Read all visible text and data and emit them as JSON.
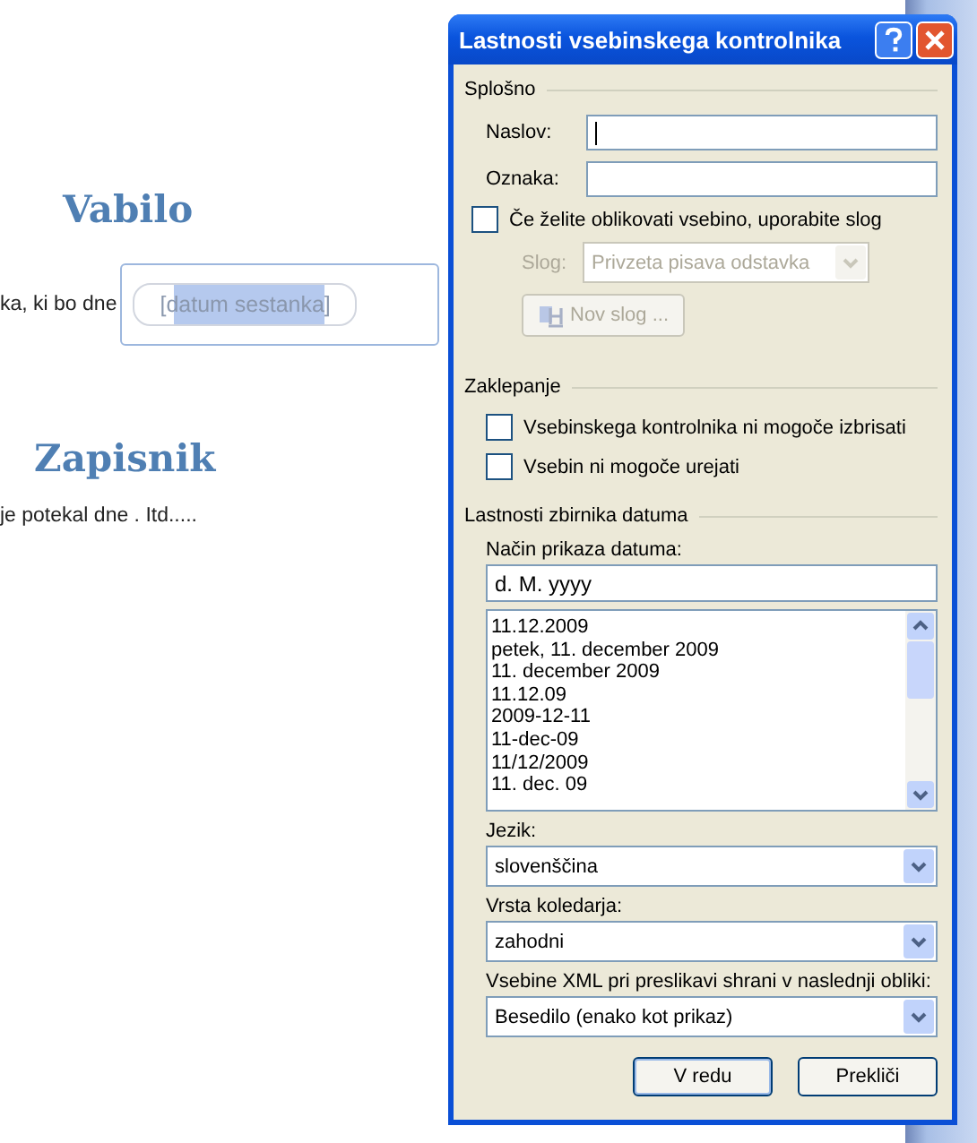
{
  "document": {
    "heading_1": "Vabilo",
    "paragraph_1": "ka, ki bo dne",
    "content_control": {
      "placeholder": "[datum sestanka]",
      "selected": true
    },
    "heading_2": "Zapisnik",
    "paragraph_2": "je potekal dne . Itd....."
  },
  "dialog": {
    "title": "Lastnosti vsebinskega kontrolnika",
    "general": {
      "heading": "Splošno",
      "title_label": "Naslov:",
      "tag_label": "Oznaka:",
      "style_checkbox": {
        "label": "Če želite oblikovati vsebino, uporabite slog",
        "checked": false
      },
      "style_label": "Slog:",
      "style_value": "Privzeta pisava odstavka",
      "style_disabled": true,
      "new_style_button": {
        "label": "Nov slog ...",
        "disabled": true
      }
    },
    "locking": {
      "heading": "Zaklepanje",
      "options": [
        {
          "label": "Vsebinskega kontrolnika ni mogoče izbrisati",
          "checked": false
        },
        {
          "label": "Vsebin ni mogoče urejati",
          "checked": false
        }
      ]
    },
    "date": {
      "heading": "Lastnosti zbirnika datuma",
      "format_label": "Način prikaza datuma:",
      "format_value": "d. M. yyyy",
      "formats": [
        "11.12.2009",
        "petek, 11. december 2009",
        "11. december 2009",
        "11.12.09",
        "2009-12-11",
        "11-dec-09",
        "11/12/2009",
        "11. dec. 09"
      ],
      "language_label": "Jezik:",
      "language_value": "slovenščina",
      "calendar_label": "Vrsta koledarja:",
      "calendar_value": "zahodni",
      "xml_label": "Vsebine XML pri preslikavi shrani v naslednji obliki:",
      "xml_value": "Besedilo (enako kot prikaz)"
    },
    "buttons": [
      {
        "label": "V redu",
        "default": true
      },
      {
        "label": "Prekliči",
        "default": false
      }
    ]
  }
}
